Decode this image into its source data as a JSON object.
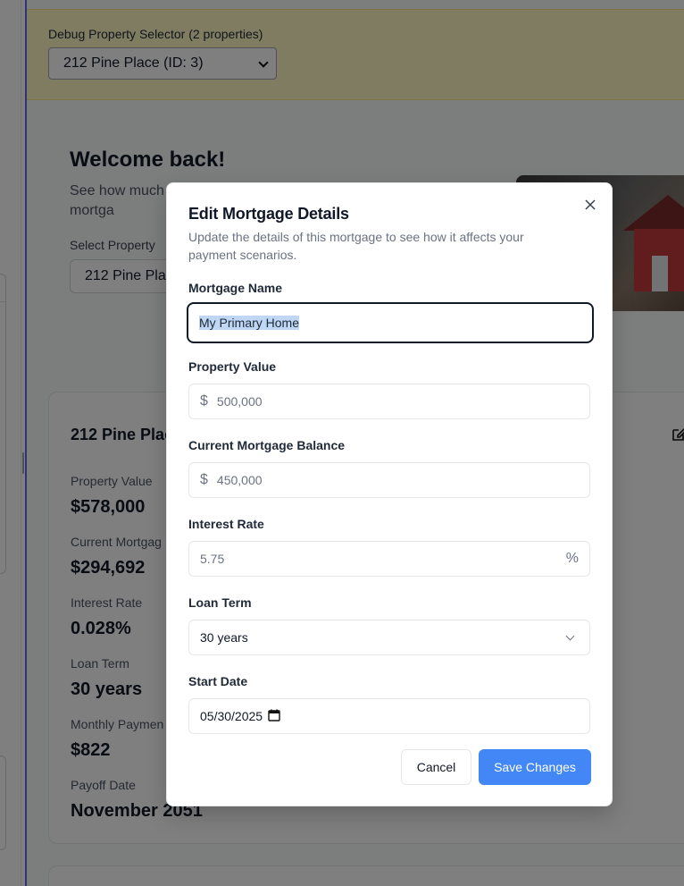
{
  "debug": {
    "label": "Debug Property Selector (2 properties)",
    "selected": "212 Pine Place (ID: 3)"
  },
  "welcome": {
    "title": "Welcome back!",
    "subtitle": "See how much on your mortga"
  },
  "property_select": {
    "label": "Select Property",
    "value": "212 Pine Plac"
  },
  "property_card": {
    "title": "212 Pine Plac",
    "stats": [
      {
        "label": "Property Value",
        "value": "$578,000"
      },
      {
        "label": "Current Mortgag",
        "value": "$294,692"
      },
      {
        "label": "Interest Rate",
        "value": "0.028%"
      },
      {
        "label": "Loan Term",
        "value": "30 years"
      },
      {
        "label": "Monthly Paymen",
        "value": "$822"
      },
      {
        "label": "Payoff Date",
        "value": "November 2051"
      }
    ]
  },
  "modal": {
    "title": "Edit Mortgage Details",
    "description": "Update the details of this mortgage to see how it affects your payment scenarios.",
    "fields": {
      "name": {
        "label": "Mortgage Name",
        "value": "My Primary Home"
      },
      "property_value": {
        "label": "Property Value",
        "prefix": "$",
        "placeholder": "500,000"
      },
      "balance": {
        "label": "Current Mortgage Balance",
        "prefix": "$",
        "placeholder": "450,000"
      },
      "rate": {
        "label": "Interest Rate",
        "placeholder": "5.75",
        "suffix": "%"
      },
      "term": {
        "label": "Loan Term",
        "value": "30 years"
      },
      "start_date": {
        "label": "Start Date",
        "value": "05/30/2025"
      }
    },
    "cancel_label": "Cancel",
    "save_label": "Save Changes"
  },
  "colors": {
    "accent": "#4287f5",
    "debug_bg": "#fef9c3",
    "overlay": "rgba(0,0,0,0.5)"
  },
  "icons": [
    "chevron-down-icon",
    "close-icon",
    "edit-icon",
    "calendar-icon"
  ]
}
